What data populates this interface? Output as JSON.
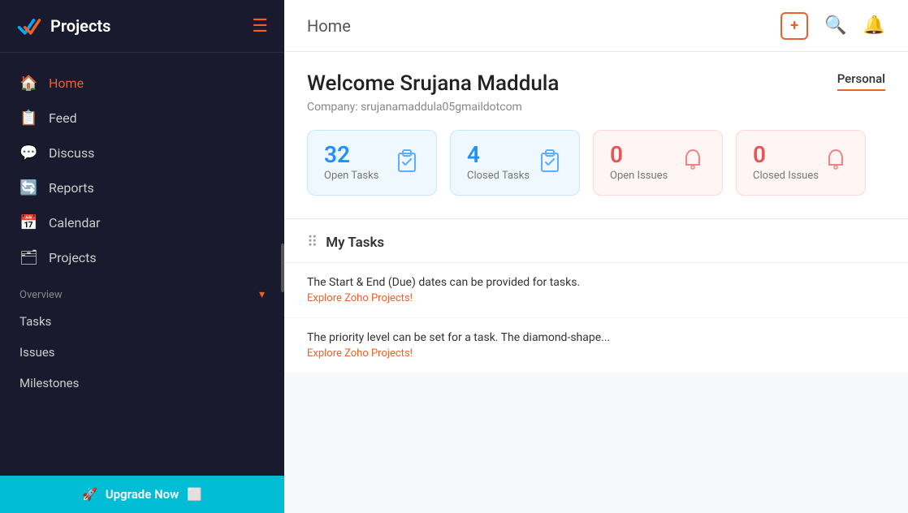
{
  "sidebar": {
    "logo_text": "Projects",
    "nav_items": [
      {
        "id": "home",
        "label": "Home",
        "icon": "🏠",
        "active": true
      },
      {
        "id": "feed",
        "label": "Feed",
        "icon": "📋"
      },
      {
        "id": "discuss",
        "label": "Discuss",
        "icon": "💬"
      },
      {
        "id": "reports",
        "label": "Reports",
        "icon": "🔄"
      },
      {
        "id": "calendar",
        "label": "Calendar",
        "icon": "📅"
      },
      {
        "id": "projects",
        "label": "Projects",
        "icon": "🗂"
      }
    ],
    "section_label": "Overview",
    "sub_items": [
      "Tasks",
      "Issues",
      "Milestones"
    ],
    "upgrade_label": "Upgrade Now"
  },
  "topbar": {
    "title": "Home",
    "add_icon": "+",
    "search_icon": "🔍",
    "bell_icon": "🔔"
  },
  "welcome": {
    "title": "Welcome Srujana Maddula",
    "company": "Company: srujanamaddula05gmaildotcom",
    "tab_label": "Personal"
  },
  "stats": [
    {
      "id": "open-tasks",
      "number": "32",
      "label": "Open Tasks",
      "color": "blue",
      "icon": "📋"
    },
    {
      "id": "closed-tasks",
      "number": "4",
      "label": "Closed Tasks",
      "color": "blue",
      "icon": "📋"
    },
    {
      "id": "open-issues",
      "number": "0",
      "label": "Open Issues",
      "color": "pink",
      "icon": "🔔"
    },
    {
      "id": "closed-issues",
      "number": "0",
      "label": "Closed Issues",
      "color": "pink",
      "icon": "🔔"
    }
  ],
  "my_tasks": {
    "header": "My Tasks",
    "items": [
      {
        "main": "The Start & End (Due) dates can be provided for tasks.",
        "sub": "Explore Zoho Projects!"
      },
      {
        "main": "The priority level can be set for a task. The diamond-shape...",
        "sub": "Explore Zoho Projects!"
      }
    ]
  }
}
